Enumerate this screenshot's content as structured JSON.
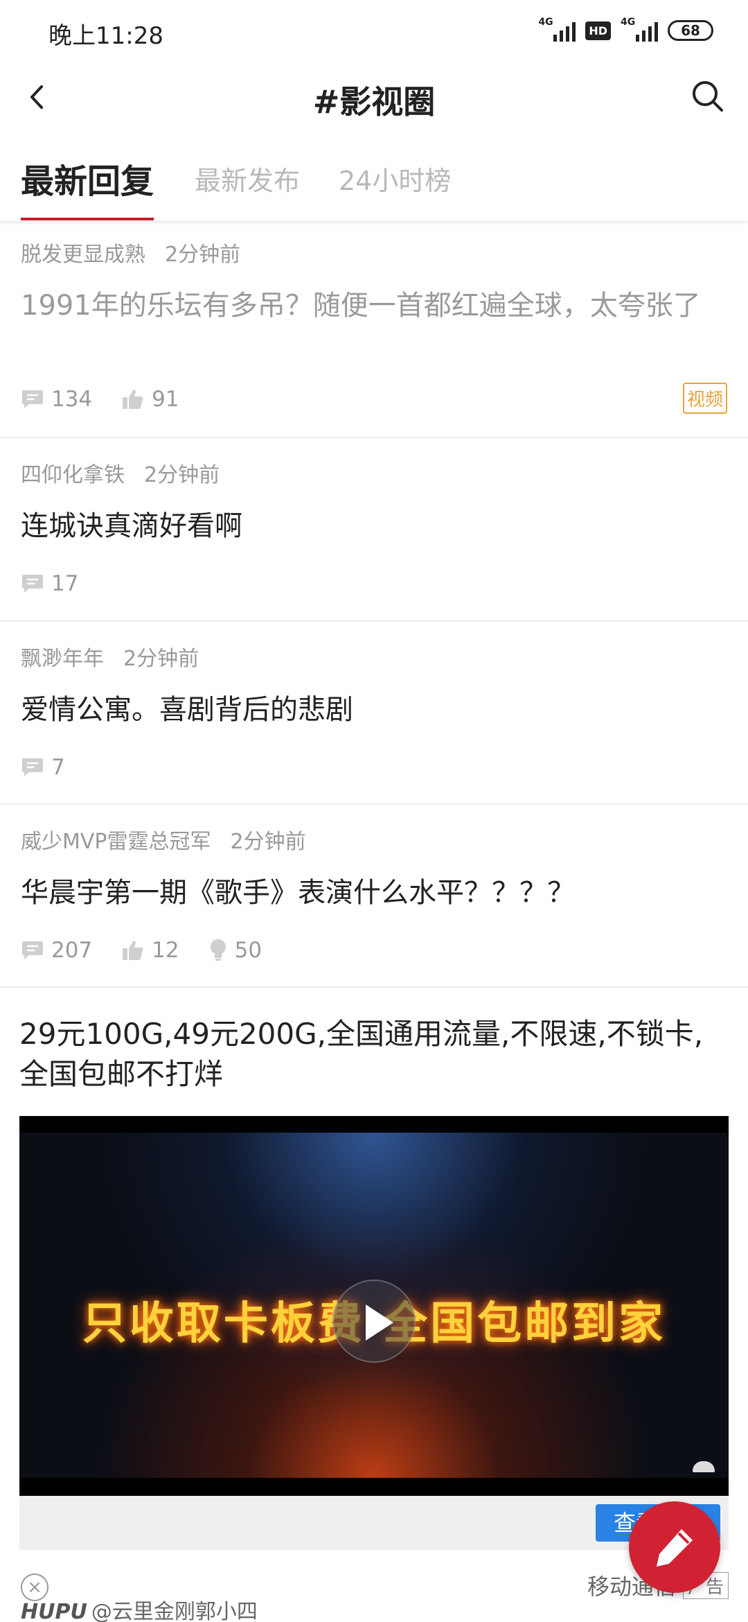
{
  "status_bar": {
    "time": "晚上11:28",
    "signal1_label": "4G",
    "hd_label": "HD",
    "signal2_label": "4G",
    "battery": "68"
  },
  "nav": {
    "title": "#影视圈",
    "back_icon": "chevron-left-icon",
    "search_icon": "search-icon"
  },
  "tabs": [
    {
      "label": "最新回复",
      "active": true
    },
    {
      "label": "最新发布",
      "active": false
    },
    {
      "label": "24小时榜",
      "active": false
    }
  ],
  "posts": [
    {
      "author": "脱发更显成熟",
      "time": "2分钟前",
      "title": "1991年的乐坛有多吊？随便一首都红遍全球，太夸张了",
      "read": true,
      "comments": "134",
      "likes": "91",
      "tag": "视频"
    },
    {
      "author": "四仰化拿铁",
      "time": "2分钟前",
      "title": "连城诀真滴好看啊",
      "comments": "17"
    },
    {
      "author": "飘渺年年",
      "time": "2分钟前",
      "title": "爱情公寓。喜剧背后的悲剧",
      "comments": "7"
    },
    {
      "author": "威少MVP雷霆总冠军",
      "time": "2分钟前",
      "title": "华晨宇第一期《歌手》表演什么水平？？？？",
      "comments": "207",
      "likes": "12",
      "hot": "50"
    }
  ],
  "ad": {
    "title": "29元100G,49元200G,全国通用流量,不限速,不锁卡,全国包邮不打烊",
    "video_slogan": "只收取卡板费 全国包邮到家",
    "cta": "查看详情",
    "source": "移动通信",
    "ad_label": "广告",
    "close": "×"
  },
  "watermark": {
    "brand": "HUPU",
    "user": "@云里金刚郭小四"
  },
  "fab_icon": "edit-pen-icon",
  "colors": {
    "accent": "#c81e2a",
    "tag": "#e8a33b",
    "cta": "#2a82e4"
  }
}
